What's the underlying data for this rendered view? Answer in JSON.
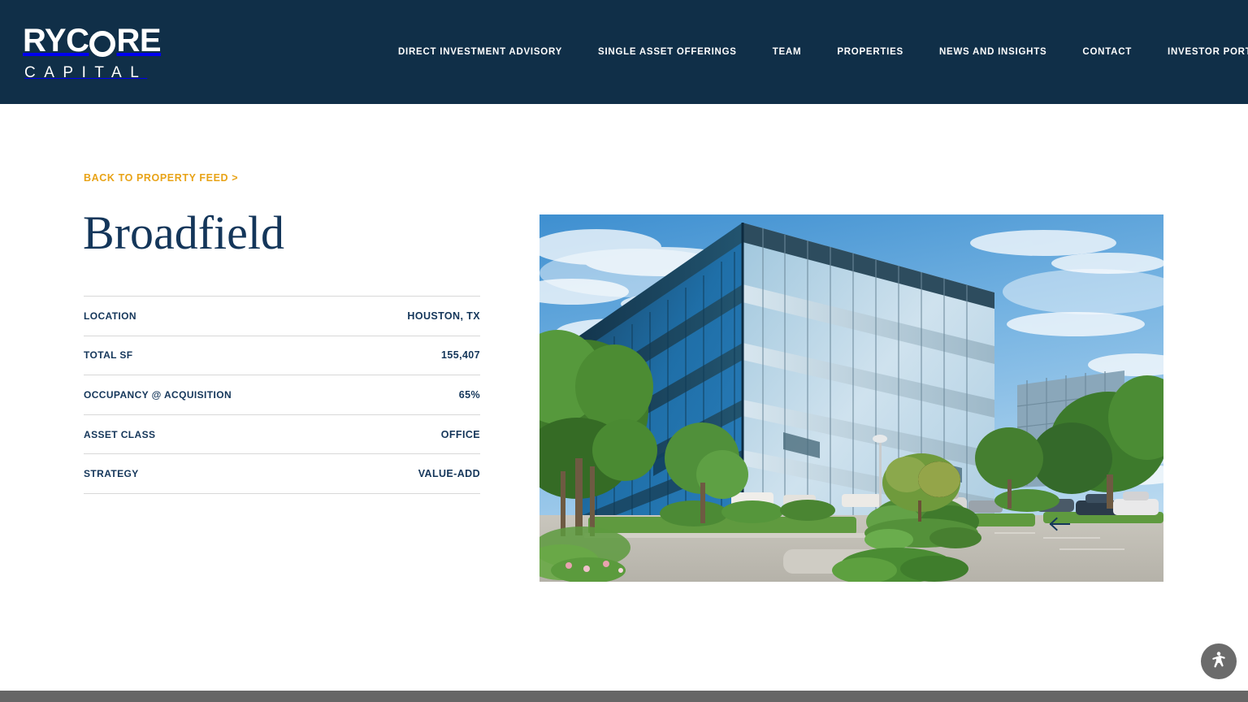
{
  "header": {
    "logo": {
      "word_before_o": "RY C",
      "brand_part1": "RY",
      "brand_part2": "C",
      "brand_part3": "RE",
      "o_icon": "circle-o-logo-mark",
      "subtitle": "CAPITAL",
      "full_brand": "RYCORE CAPITAL"
    },
    "nav": [
      {
        "label": "DIRECT INVESTMENT ADVISORY",
        "name": "nav-direct-investment-advisory"
      },
      {
        "label": "SINGLE ASSET OFFERINGS",
        "name": "nav-single-asset-offerings"
      },
      {
        "label": "TEAM",
        "name": "nav-team"
      },
      {
        "label": "PROPERTIES",
        "name": "nav-properties"
      },
      {
        "label": "NEWS AND INSIGHTS",
        "name": "nav-news-and-insights"
      },
      {
        "label": "CONTACT",
        "name": "nav-contact"
      },
      {
        "label": "INVESTOR PORTAL",
        "name": "nav-investor-portal"
      }
    ]
  },
  "main": {
    "back_link": "BACK TO PROPERTY FEED >",
    "property_title": "Broadfield",
    "specs": [
      {
        "label": "LOCATION",
        "value": "HOUSTON, TX"
      },
      {
        "label": "TOTAL SF",
        "value": "155,407"
      },
      {
        "label": "OCCUPANCY @ ACQUISITION",
        "value": "65%"
      },
      {
        "label": "ASSET CLASS",
        "value": "OFFICE"
      },
      {
        "label": "STRATEGY",
        "value": "VALUE-ADD"
      }
    ]
  },
  "carousel": {
    "prev_icon": "arrow-left-icon",
    "next_icon": "arrow-right-icon",
    "image_alt": "Broadfield glass office building exterior with parking lot and trees"
  },
  "widgets": {
    "accessibility_icon": "accessibility-person-icon"
  },
  "colors": {
    "header_navy": "#102f48",
    "text_navy": "#14365a",
    "accent_amber": "#e8a317",
    "divider_grey": "#d8d8d8",
    "footer_grey": "#666666",
    "a11y_grey": "#6b6b6b"
  }
}
